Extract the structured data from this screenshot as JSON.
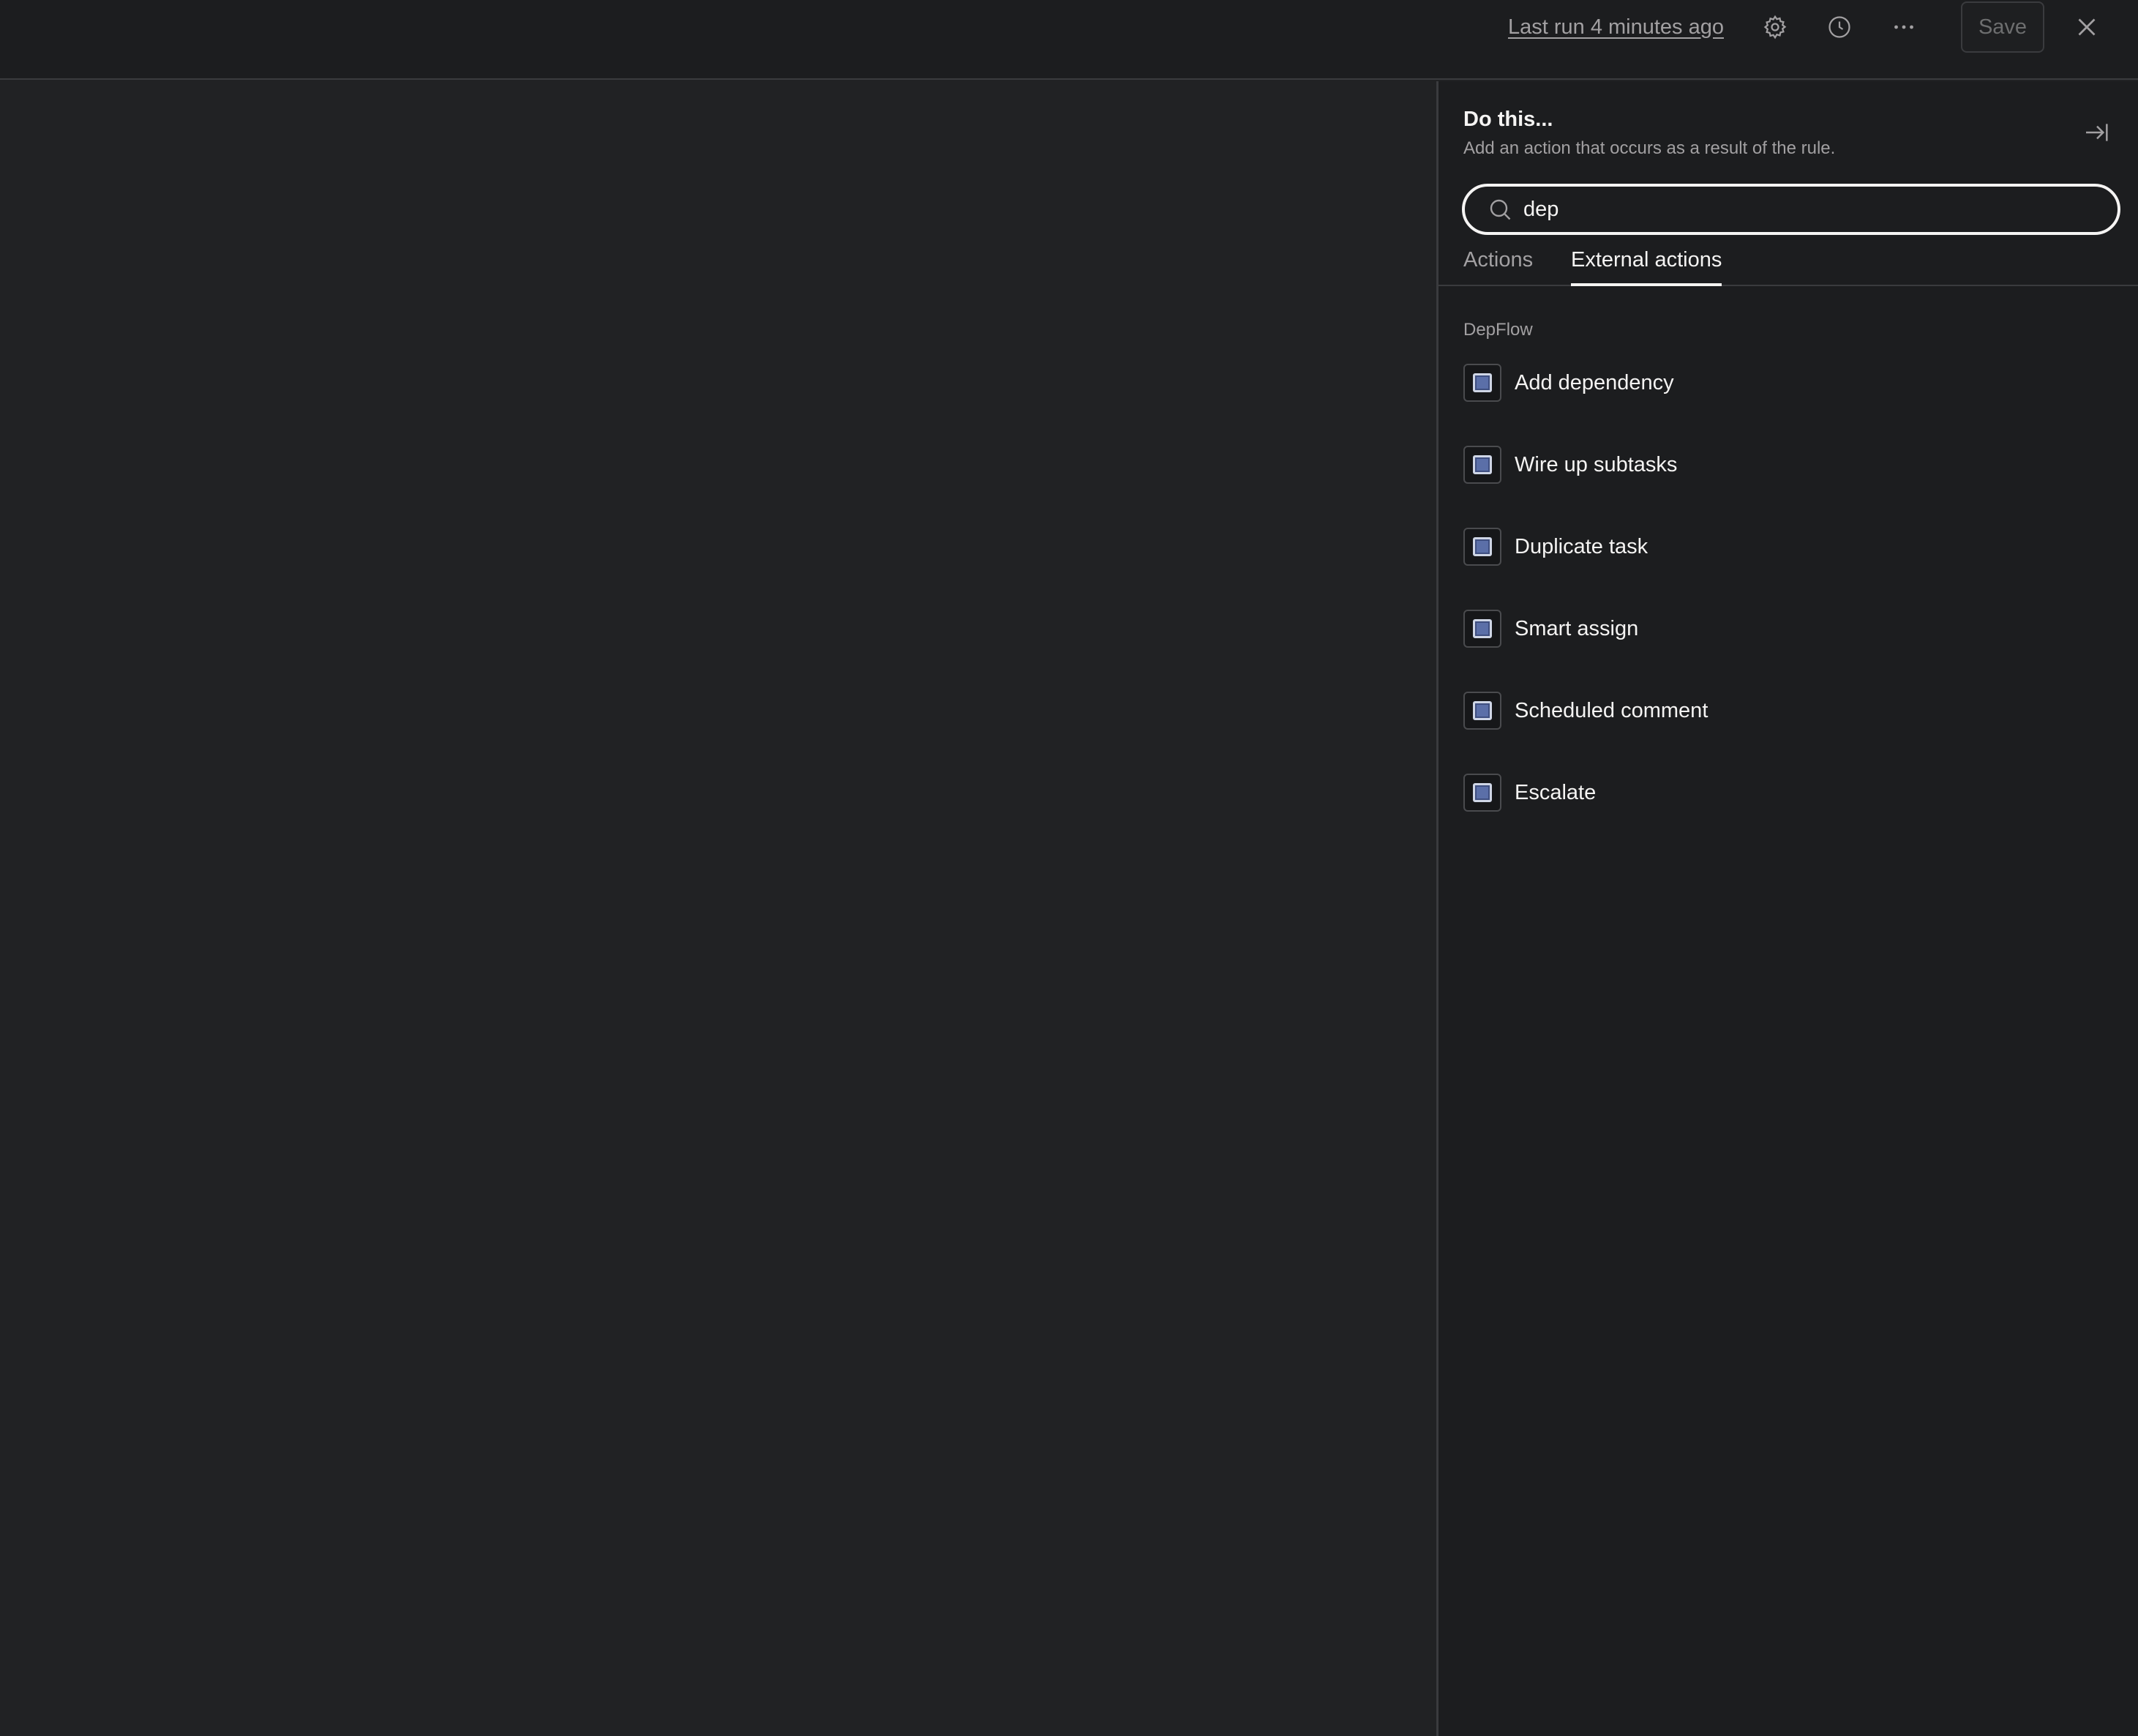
{
  "topbar": {
    "last_run": "Last run 4 minutes ago",
    "icons": [
      "gear-icon",
      "clock-icon",
      "more-icon",
      "close-icon"
    ],
    "save_label": "Save"
  },
  "panel": {
    "title": "Do this...",
    "subtitle": "Add an action that occurs as a result of the rule.",
    "search": {
      "value": "dep",
      "placeholder": ""
    },
    "tabs": [
      {
        "label": "Actions",
        "active": false
      },
      {
        "label": "External actions",
        "active": true
      }
    ],
    "group_label": "DepFlow",
    "actions": [
      {
        "label": "Add dependency"
      },
      {
        "label": "Wire up subtasks"
      },
      {
        "label": "Duplicate task"
      },
      {
        "label": "Smart assign"
      },
      {
        "label": "Scheduled comment"
      },
      {
        "label": "Escalate"
      }
    ]
  },
  "colors": {
    "background": "#212224",
    "panel": "#1c1d1f",
    "border": "#3a3b3e",
    "text": "#f5f4f3",
    "muted": "#a2a0a2",
    "app_icon": "#5b6fa8"
  }
}
